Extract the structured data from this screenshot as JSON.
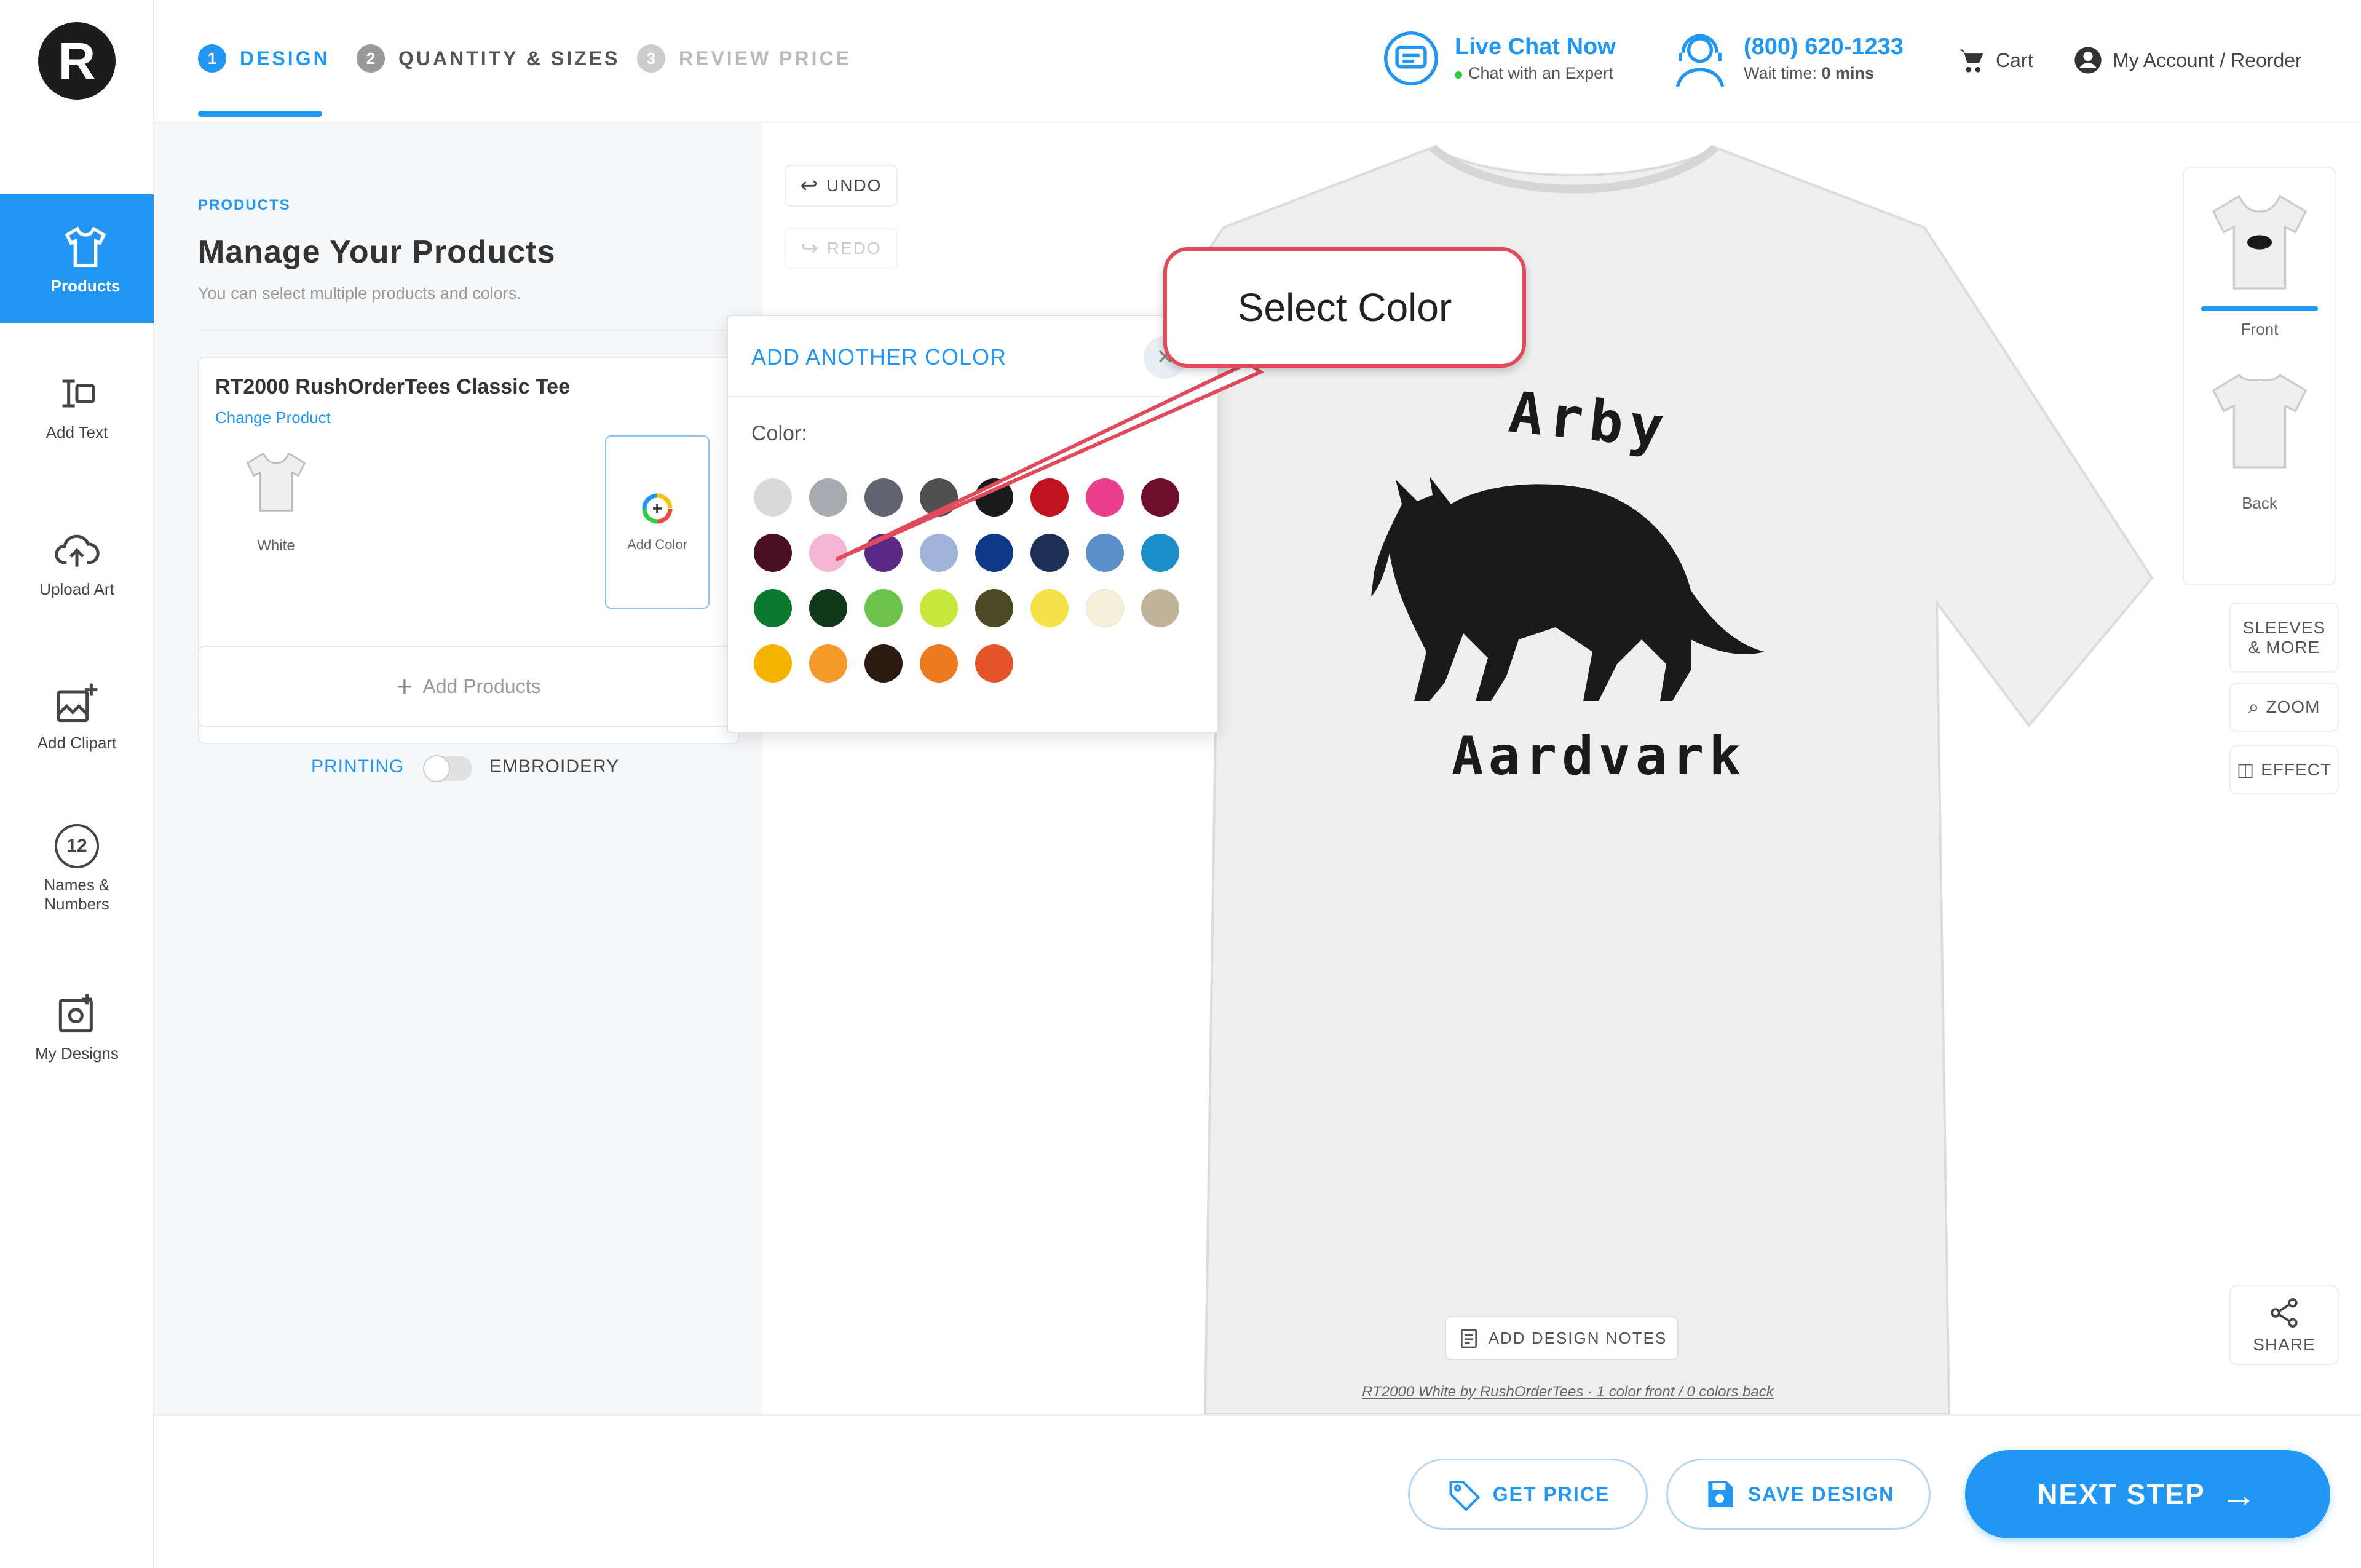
{
  "rail": {
    "items": [
      {
        "label": "Products",
        "icon": "tshirt-icon"
      },
      {
        "label": "Add Text",
        "icon": "text-icon"
      },
      {
        "label": "Upload Art",
        "icon": "upload-cloud-icon"
      },
      {
        "label": "Add Clipart",
        "icon": "image-plus-icon"
      },
      {
        "label": "Names & Numbers",
        "icon": "number-badge-icon"
      },
      {
        "label": "My Designs",
        "icon": "saved-designs-icon"
      }
    ],
    "names_numbers_badge": "12"
  },
  "header": {
    "steps": [
      {
        "num": "1",
        "label": "DESIGN"
      },
      {
        "num": "2",
        "label": "QUANTITY & SIZES"
      },
      {
        "num": "3",
        "label": "REVIEW PRICE"
      }
    ],
    "chat": {
      "title": "Live Chat Now",
      "subtitle": "Chat with an Expert"
    },
    "phone": {
      "number": "(800) 620-1233",
      "wait_prefix": "Wait time:",
      "wait_value": "0 mins"
    },
    "cart": "Cart",
    "account": "My Account / Reorder"
  },
  "panel": {
    "eyebrow": "PRODUCTS",
    "title": "Manage Your Products",
    "subtitle": "You can select multiple products and colors.",
    "product_name": "RT2000 RushOrderTees Classic Tee",
    "change_product": "Change Product",
    "product_color": "White",
    "add_color": "Add Color",
    "add_products": "Add Products",
    "printing": "PRINTING",
    "embroidery": "EMBROIDERY"
  },
  "color_popup": {
    "title": "ADD ANOTHER COLOR",
    "color_label": "Color:",
    "swatches": [
      "#d9d9d9",
      "#a9a9b0",
      "#5f6470",
      "#505050",
      "#1a1a1a",
      "#c1121f",
      "#e83e8c",
      "#6d0f2c",
      "#4a0f22",
      "#f4b6d2",
      "#5b2a86",
      "#9fb4d8",
      "#0f3a8a",
      "#1e2f55",
      "#5b8fc9",
      "#1a8fc9",
      "#0b7a2e",
      "#10391c",
      "#6cc24a",
      "#c6e83a",
      "#4b4a24",
      "#f7e14a",
      "#f7efd8",
      "#bfb39a",
      "#f5b400",
      "#f59a2a",
      "#2b1a0f",
      "#ee7a1f",
      "#e5532a"
    ]
  },
  "callout": {
    "text": "Select Color"
  },
  "canvas": {
    "undo": "UNDO",
    "redo": "REDO",
    "design_top_text": "Arby",
    "design_bottom_text": "Aardvark",
    "add_design_notes": "ADD DESIGN NOTES",
    "footer_text": "RT2000 White by RushOrderTees · 1 color front / 0 colors back"
  },
  "side_tools": {
    "front": "Front",
    "back": "Back",
    "sleeves": "SLEEVES & MORE",
    "zoom": "ZOOM",
    "effect": "EFFECT",
    "share": "SHARE"
  },
  "bottom": {
    "get_price": "GET PRICE",
    "save_design": "SAVE DESIGN",
    "next_step": "NEXT STEP"
  },
  "colors": {
    "accent": "#2196f3",
    "callout_border": "#e04a5a",
    "shirt": "#f2f2f2"
  }
}
